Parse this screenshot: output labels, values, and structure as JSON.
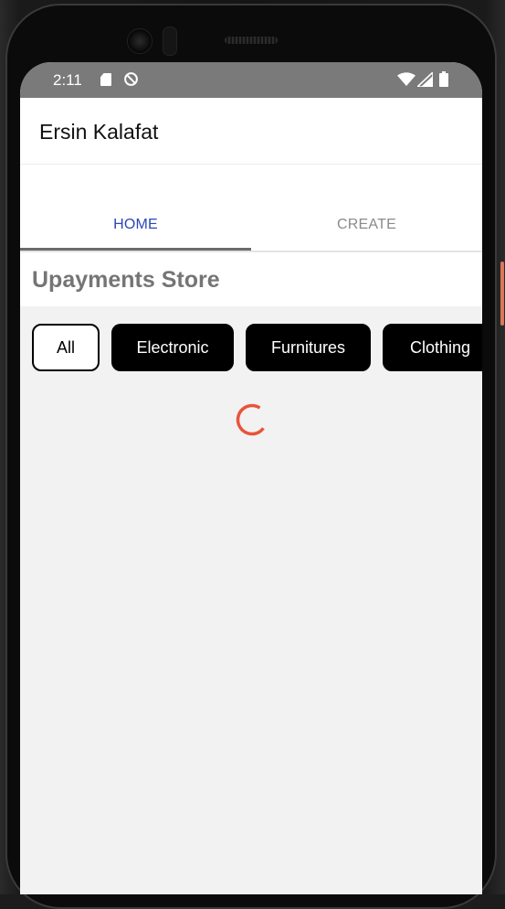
{
  "status_bar": {
    "time": "2:11",
    "icons": [
      "sd-card-icon",
      "sync-icon",
      "wifi-icon",
      "signal-icon",
      "battery-icon"
    ]
  },
  "app_bar": {
    "title": "Ersin Kalafat"
  },
  "tabs": [
    {
      "label": "HOME",
      "active": true
    },
    {
      "label": "CREATE",
      "active": false
    }
  ],
  "store": {
    "title": "Upayments Store"
  },
  "categories": [
    {
      "label": "All",
      "selected": true
    },
    {
      "label": "Electronic",
      "selected": false
    },
    {
      "label": "Furnitures",
      "selected": false
    },
    {
      "label": "Clothing",
      "selected": false
    }
  ],
  "colors": {
    "tab_active": "#2d46b9",
    "tab_inactive": "#8a8a8a",
    "spinner": "#e8553a",
    "status_bar": "#7a7a7a",
    "background": "#f2f2f2"
  }
}
